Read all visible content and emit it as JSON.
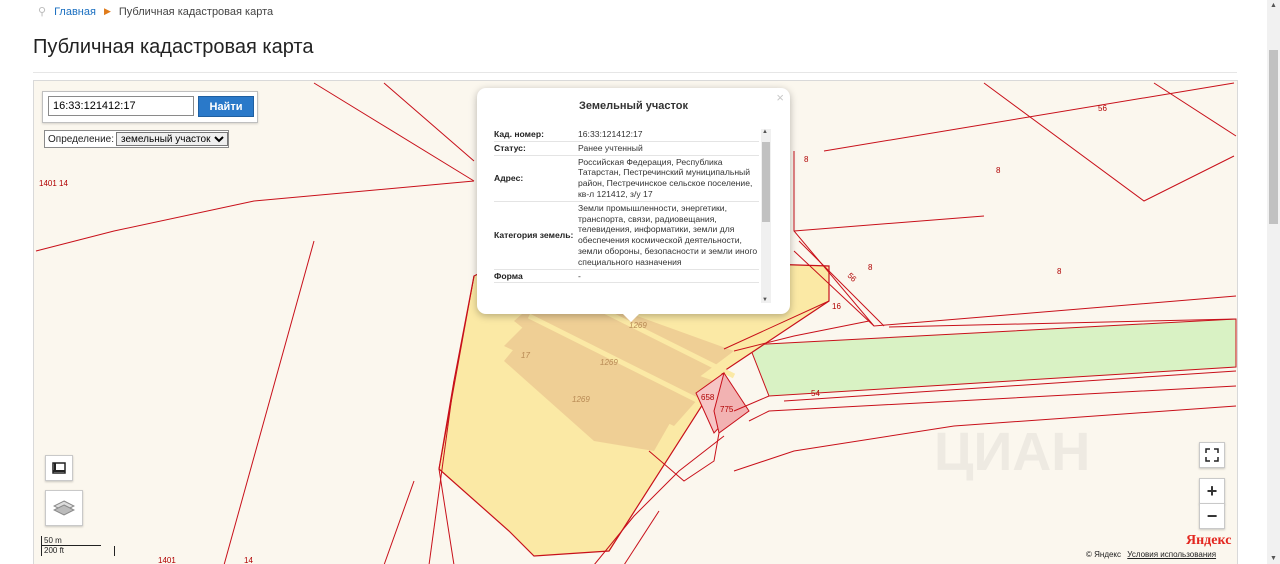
{
  "breadcrumb": {
    "home": "Главная",
    "current": "Публичная кадастровая карта"
  },
  "page_title": "Публичная кадастровая карта",
  "search": {
    "value": "16:33:121412:17",
    "button": "Найти"
  },
  "definition": {
    "label": "Определение:",
    "selected": "земельный участок"
  },
  "popup": {
    "title": "Земельный участок",
    "close": "×",
    "rows": [
      {
        "key": "Кад. номер:",
        "value": "16:33:121412:17"
      },
      {
        "key": "Статус:",
        "value": "Ранее учтенный"
      },
      {
        "key": "Адрес:",
        "value": "Российская Федерация, Республика Татарстан, Пестречинский муниципальный район, Пестречинское сельское поселение, кв-л 121412, з/у 17"
      },
      {
        "key": "Категория земель:",
        "value": "Земли промышленности, энергетики, транспорта, связи, радиовещания, телевидения, информатики, земли для обеспечения космической деятельности, земли обороны, безопасности и земли иного специального назначения"
      },
      {
        "key": "Форма",
        "value": "-"
      }
    ]
  },
  "map_labels": {
    "l56a": "56",
    "l56b": "56",
    "l8a": "8",
    "l8b": "8",
    "l8c": "8",
    "l8d": "8",
    "l16": "16",
    "l54": "54",
    "l1401_14": "1401 14",
    "l1401": "1401",
    "l14": "14",
    "l1269a": "1269",
    "l1269b": "1269",
    "l1269c": "1269",
    "l17": "17",
    "l658": "658",
    "l775": "775"
  },
  "scale": {
    "metric": "50 m",
    "imperial": "200 ft"
  },
  "attribution": {
    "logo": "Яндекс",
    "copyright": "© Яндекс",
    "terms": "Условия использования"
  },
  "watermark": "ЦИАН",
  "icons": {
    "zoom_in": "+",
    "zoom_out": "−",
    "fullscreen": "fullscreen-icon",
    "ruler": "ruler-icon",
    "layers": "layers-icon"
  },
  "colors": {
    "parcel_fill": "#fbe9a5",
    "inner_fill": "#efcf95",
    "green": "#d9f2c4",
    "boundary": "#c8101a",
    "accent": "#2a79c9"
  }
}
